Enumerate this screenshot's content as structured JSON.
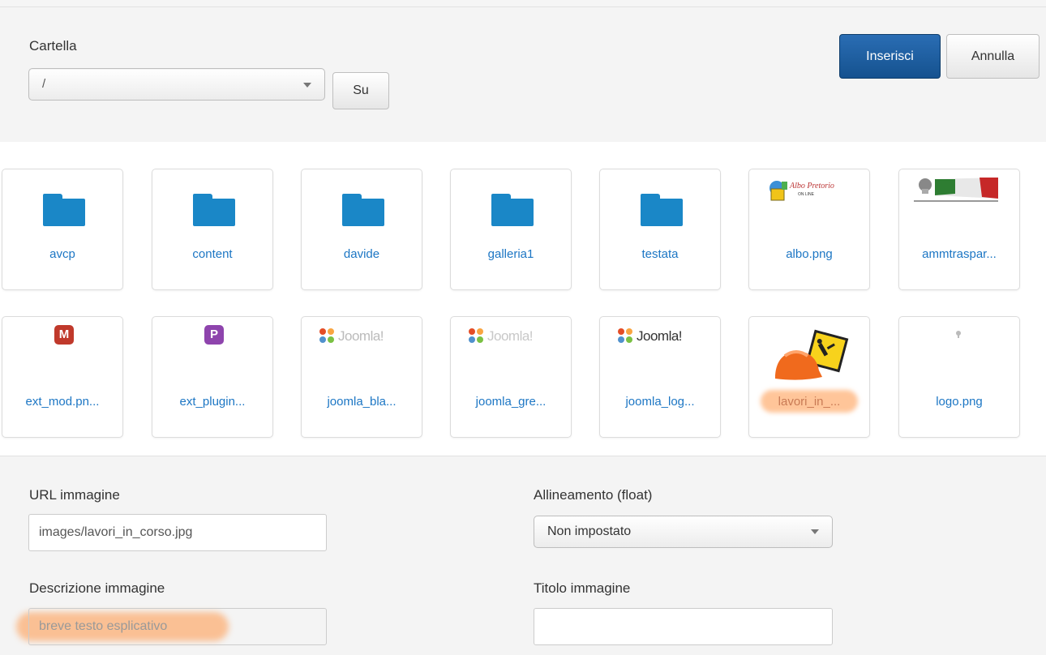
{
  "header": {
    "folder_label": "Cartella",
    "folder_value": "/",
    "up_button": "Su",
    "insert_button": "Inserisci",
    "cancel_button": "Annulla"
  },
  "colors": {
    "primary": "#1a5a9a",
    "folder_icon": "#1a87c7",
    "link_text": "#1c76c4",
    "highlight": "#ff9646"
  },
  "items_row1": [
    {
      "name": "avcp",
      "icon": "folder-icon"
    },
    {
      "name": "content",
      "icon": "folder-icon"
    },
    {
      "name": "davide",
      "icon": "folder-icon"
    },
    {
      "name": "galleria1",
      "icon": "folder-icon"
    },
    {
      "name": "testata",
      "icon": "folder-icon"
    },
    {
      "name": "albo.png",
      "icon": "albo-pretorio-thumbnail",
      "logo_text": "Albo Pretorio",
      "logo_sub": "ON LINE"
    },
    {
      "name": "ammtraspar...",
      "icon": "amministrazione-trasparente-thumbnail"
    }
  ],
  "items_row2": [
    {
      "name": "ext_mod.pn...",
      "icon": "module-badge-icon",
      "badge": "M",
      "badge_color": "#c0392b"
    },
    {
      "name": "ext_plugin...",
      "icon": "plugin-badge-icon",
      "badge": "P",
      "badge_color": "#8e44ad"
    },
    {
      "name": "joomla_bla...",
      "icon": "joomla-logo-thumbnail",
      "logo_word": "Joomla!"
    },
    {
      "name": "joomla_gre...",
      "icon": "joomla-logo-thumbnail",
      "logo_word": "Joomla!"
    },
    {
      "name": "joomla_log...",
      "icon": "joomla-logo-thumbnail",
      "logo_word": "Joomla!"
    },
    {
      "name": "lavori_in_...",
      "icon": "work-in-progress-thumbnail",
      "selected": true
    },
    {
      "name": "logo.png",
      "icon": "small-logo-thumbnail"
    }
  ],
  "form": {
    "url_label": "URL immagine",
    "url_value": "images/lavori_in_corso.jpg",
    "align_label": "Allineamento (float)",
    "align_value": "Non impostato",
    "desc_label": "Descrizione immagine",
    "desc_placeholder": "breve testo esplicativo",
    "title_label": "Titolo immagine",
    "title_value": ""
  }
}
